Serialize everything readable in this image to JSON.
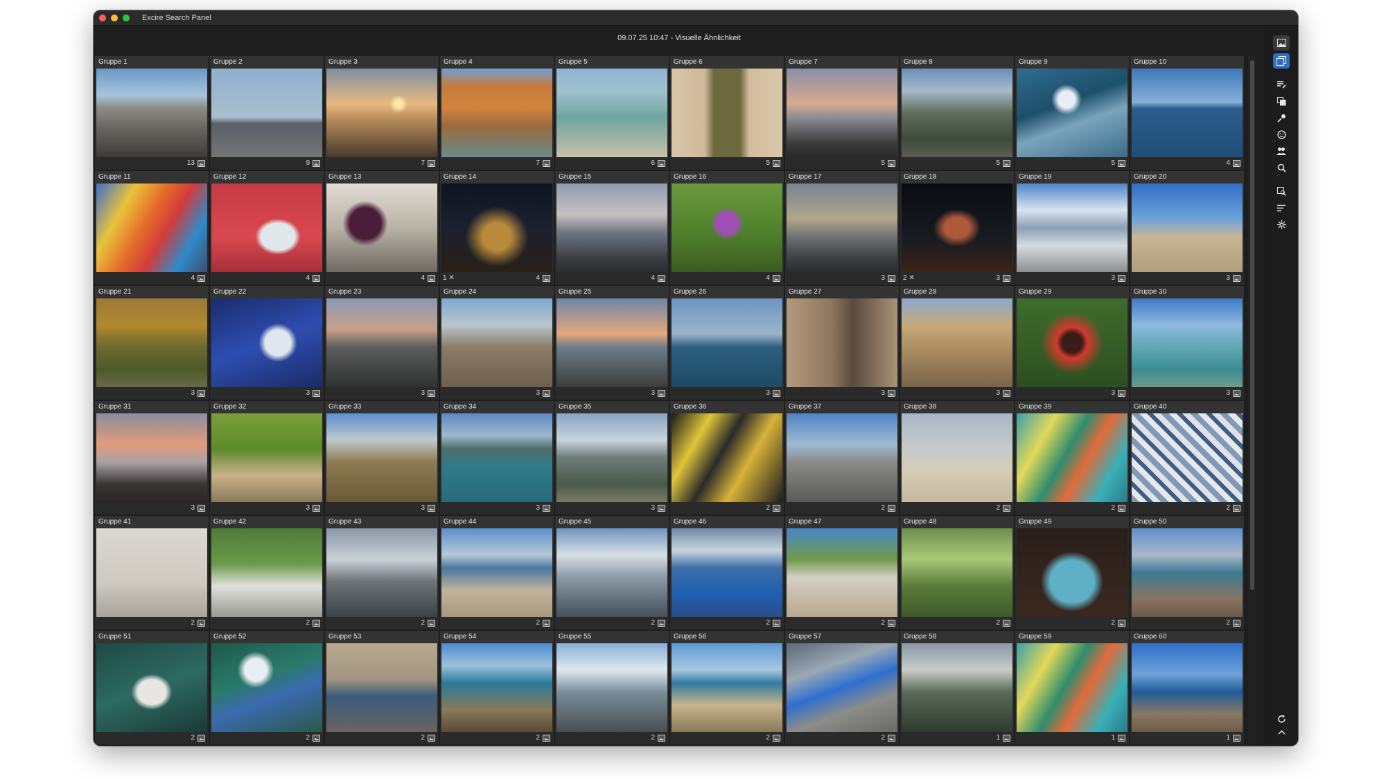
{
  "app": {
    "title": "Excire Search Panel"
  },
  "header": {
    "title": "09.07.25 10:47 - Visuelle Ähnlichkeit"
  },
  "toolbar": {
    "icons": [
      "image-icon",
      "image-stack-icon",
      "edit-list-icon",
      "copy-icon",
      "tag-icon",
      "face-icon",
      "people-icon",
      "search-icon",
      "duplicate-search-icon",
      "sort-icon",
      "magic-icon",
      "refresh-icon",
      "chevron-up-icon"
    ]
  },
  "colors": {
    "window_bg": "#1e1e1e",
    "accent": "#2f6fbd",
    "tile_label_bg": "#333333"
  },
  "groups": [
    {
      "label": "Gruppe 1",
      "count": "13"
    },
    {
      "label": "Gruppe 2",
      "count": "9"
    },
    {
      "label": "Gruppe 3",
      "count": "7"
    },
    {
      "label": "Gruppe 4",
      "count": "7"
    },
    {
      "label": "Gruppe 5",
      "count": "6"
    },
    {
      "label": "Gruppe 6",
      "count": "5"
    },
    {
      "label": "Gruppe 7",
      "count": "5"
    },
    {
      "label": "Gruppe 8",
      "count": "5"
    },
    {
      "label": "Gruppe 9",
      "count": "5"
    },
    {
      "label": "Gruppe 10",
      "count": "4"
    },
    {
      "label": "Gruppe 11",
      "count": "4"
    },
    {
      "label": "Gruppe 12",
      "count": "4"
    },
    {
      "label": "Gruppe 13",
      "count": "4"
    },
    {
      "label": "Gruppe 14",
      "count": "4",
      "rejected": "1"
    },
    {
      "label": "Gruppe 15",
      "count": "4"
    },
    {
      "label": "Gruppe 16",
      "count": "4"
    },
    {
      "label": "Gruppe 17",
      "count": "3"
    },
    {
      "label": "Gruppe 18",
      "count": "3",
      "rejected": "2"
    },
    {
      "label": "Gruppe 19",
      "count": "3"
    },
    {
      "label": "Gruppe 20",
      "count": "3"
    },
    {
      "label": "Gruppe 21",
      "count": "3"
    },
    {
      "label": "Gruppe 22",
      "count": "3"
    },
    {
      "label": "Gruppe 23",
      "count": "3"
    },
    {
      "label": "Gruppe 24",
      "count": "3"
    },
    {
      "label": "Gruppe 25",
      "count": "3"
    },
    {
      "label": "Gruppe 26",
      "count": "3"
    },
    {
      "label": "Gruppe 27",
      "count": "3"
    },
    {
      "label": "Gruppe 28",
      "count": "3"
    },
    {
      "label": "Gruppe 29",
      "count": "3"
    },
    {
      "label": "Gruppe 30",
      "count": "3"
    },
    {
      "label": "Gruppe 31",
      "count": "3"
    },
    {
      "label": "Gruppe 32",
      "count": "3"
    },
    {
      "label": "Gruppe 33",
      "count": "3"
    },
    {
      "label": "Gruppe 34",
      "count": "3"
    },
    {
      "label": "Gruppe 35",
      "count": "3"
    },
    {
      "label": "Gruppe 36",
      "count": "2"
    },
    {
      "label": "Gruppe 37",
      "count": "2"
    },
    {
      "label": "Gruppe 38",
      "count": "2"
    },
    {
      "label": "Gruppe 39",
      "count": "2"
    },
    {
      "label": "Gruppe 40",
      "count": "2"
    },
    {
      "label": "Gruppe 41",
      "count": "2"
    },
    {
      "label": "Gruppe 42",
      "count": "2"
    },
    {
      "label": "Gruppe 43",
      "count": "2"
    },
    {
      "label": "Gruppe 44",
      "count": "2"
    },
    {
      "label": "Gruppe 45",
      "count": "2"
    },
    {
      "label": "Gruppe 46",
      "count": "2"
    },
    {
      "label": "Gruppe 47",
      "count": "2"
    },
    {
      "label": "Gruppe 48",
      "count": "2"
    },
    {
      "label": "Gruppe 49",
      "count": "2"
    },
    {
      "label": "Gruppe 50",
      "count": "2"
    },
    {
      "label": "Gruppe 51",
      "count": "2"
    },
    {
      "label": "Gruppe 52",
      "count": "2"
    },
    {
      "label": "Gruppe 53",
      "count": "2"
    },
    {
      "label": "Gruppe 54",
      "count": "2"
    },
    {
      "label": "Gruppe 55",
      "count": "2"
    },
    {
      "label": "Gruppe 56",
      "count": "2"
    },
    {
      "label": "Gruppe 57",
      "count": "2"
    },
    {
      "label": "Gruppe 58",
      "count": "1"
    },
    {
      "label": "Gruppe 59",
      "count": "1"
    },
    {
      "label": "Gruppe 60",
      "count": "1"
    }
  ]
}
